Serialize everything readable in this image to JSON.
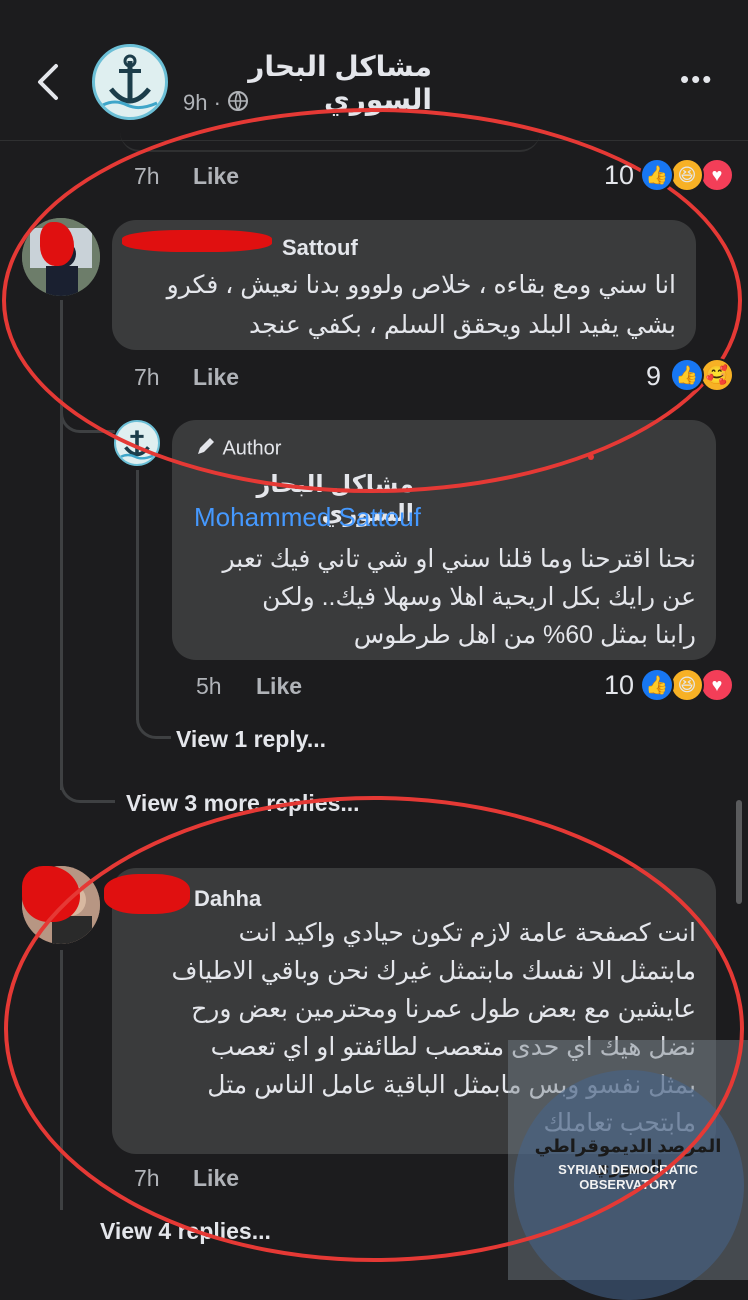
{
  "header": {
    "page_name": "مشاكل البحار السوري",
    "time": "9h",
    "more_label": "•••"
  },
  "comments": {
    "top": {
      "time": "7h",
      "like": "Like",
      "count": "10"
    },
    "c1": {
      "name": "Sattouf",
      "text_lines": [
        "انا سني ومع بقاءه ، خلاص ولووو بدنا نعيش ، فكرو",
        "بشي يفيد البلد ويحقق السلم ، بكفي عنجد"
      ],
      "time": "7h",
      "like": "Like",
      "count": "9"
    },
    "reply": {
      "badge": "Author",
      "name": "مشاكل البحار السوري",
      "mention": "Mohammed Sattouf",
      "text_lines": [
        "نحنا اقترحنا وما قلنا سني او شي تاني فيك تعبر",
        "عن رايك بكل اريحية اهلا وسهلا فيك.. ولكن",
        "رابنا بمثل 60% من اهل طرطوس"
      ],
      "time": "5h",
      "like": "Like",
      "count": "10"
    },
    "view_1": "View 1 reply...",
    "view_3": "View 3 more replies...",
    "c2": {
      "name": "Dahha",
      "text_lines": [
        "انت كصفحة عامة لازم تكون حيادي واكيد انت",
        "مابتمثل الا نفسك مابتمثل غيرك نحن وباقي الاطياف",
        "عايشين مع بعض طول عمرنا ومحترمين بعض ورح",
        "نضل هيك اي حدى متعصب لطائفتو او اي تعصب",
        "بمثل نفسو وبس مابمثل الباقية عامل الناس متل",
        "مابتحب تعاملك"
      ],
      "time": "7h",
      "like": "Like"
    },
    "view_4": "View 4 replies..."
  },
  "watermark": {
    "ar": "المرصد الديموقراطي السوري",
    "en": "SYRIAN DEMOCRATIC OBSERVATORY"
  },
  "colors": {
    "like_blue": "#1877f2",
    "love_red": "#f33e58",
    "haha_yellow": "#f7b125",
    "annotation_red": "#e53935"
  }
}
